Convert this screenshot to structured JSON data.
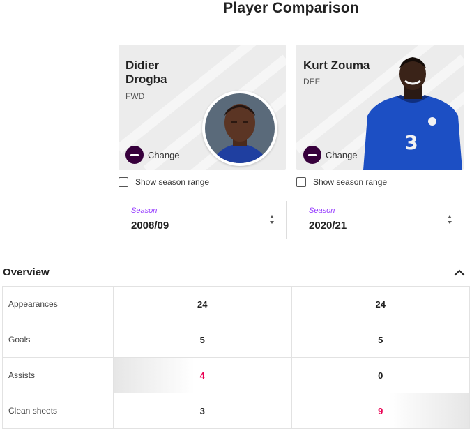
{
  "page": {
    "title": "Player Comparison"
  },
  "colors": {
    "accent": "#37003c",
    "season_caption": "#963cff",
    "winner": "#e90052"
  },
  "players": [
    {
      "first_name": "Didier",
      "last_name": "Drogba",
      "position": "FWD",
      "change_label": "Change",
      "show_range_label": "Show season range",
      "season_caption": "Season",
      "season": "2008/09"
    },
    {
      "full_name": "Kurt Zouma",
      "position": "DEF",
      "change_label": "Change",
      "show_range_label": "Show season range",
      "season_caption": "Season",
      "season": "2020/21"
    }
  ],
  "overview": {
    "title": "Overview",
    "rows": [
      {
        "label": "Appearances",
        "left": "24",
        "right": "24"
      },
      {
        "label": "Goals",
        "left": "5",
        "right": "5"
      },
      {
        "label": "Assists",
        "left": "4",
        "right": "0"
      },
      {
        "label": "Clean sheets",
        "left": "3",
        "right": "9"
      }
    ]
  }
}
